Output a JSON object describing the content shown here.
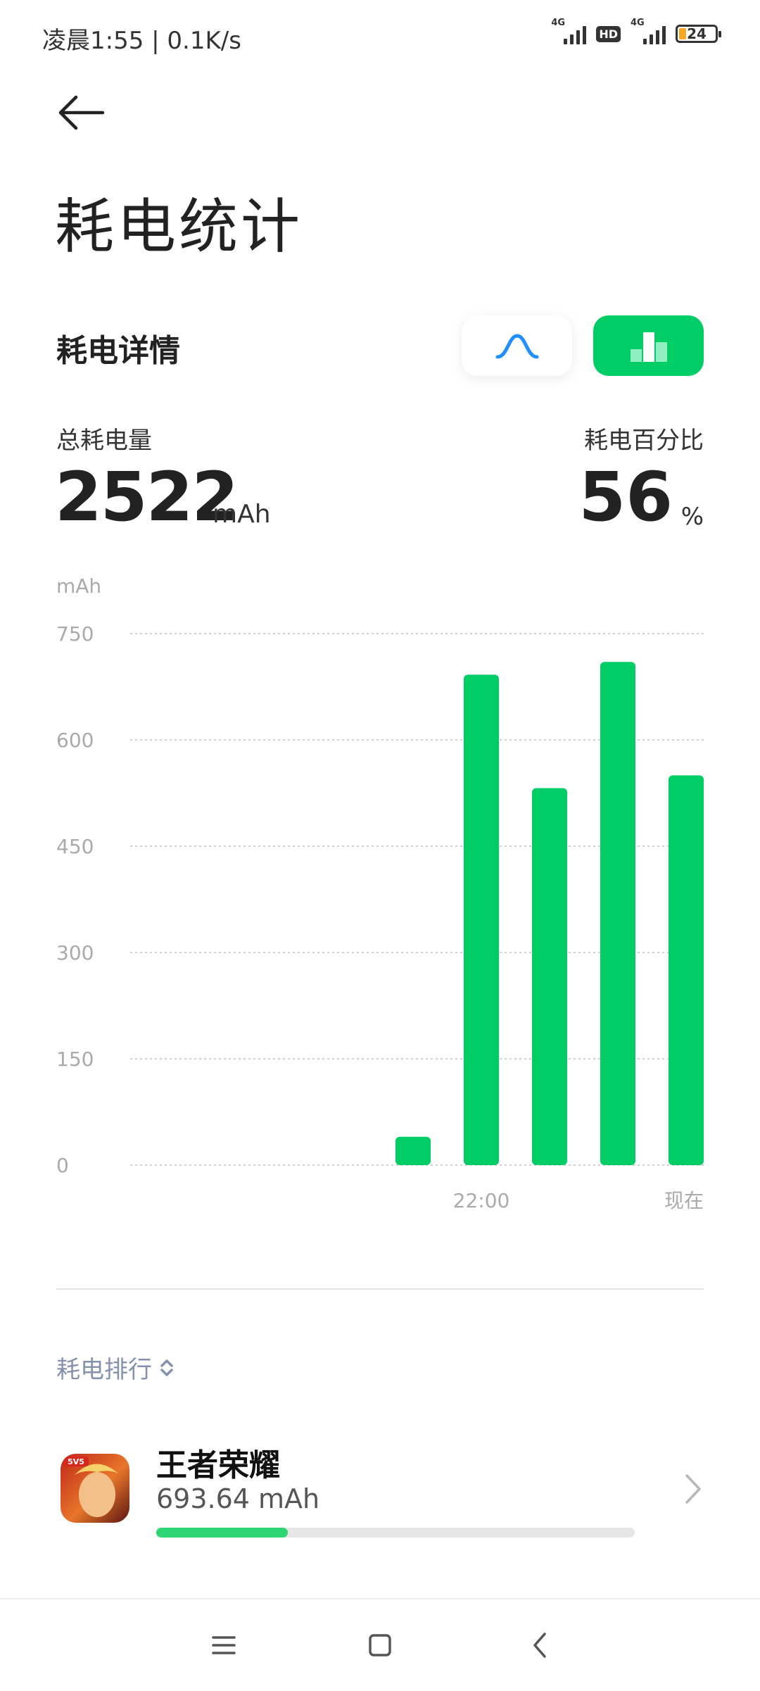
{
  "status_bar": {
    "time_text": "凌晨1:55 | 0.1K/s",
    "network1": "4G",
    "hd": "HD",
    "network2": "4G",
    "battery": "24"
  },
  "header": {
    "title": "耗电统计"
  },
  "details": {
    "title": "耗电详情",
    "view_modes": [
      "curve",
      "bar"
    ],
    "selected_view": "bar",
    "total_label": "总耗电量",
    "total_value": "2522",
    "total_unit": "mAh",
    "percent_label": "耗电百分比",
    "percent_value": "56",
    "percent_unit": "%"
  },
  "chart_data": {
    "type": "bar",
    "ylabel": "mAh",
    "ylim": [
      0,
      750
    ],
    "yticks": [
      "750",
      "600",
      "450",
      "300",
      "150",
      "0"
    ],
    "xtick_labels": [
      {
        "index": 5,
        "label": "22:00"
      },
      {
        "index": 8,
        "label": "现在"
      }
    ],
    "values": [
      0,
      0,
      0,
      0,
      40,
      692,
      532,
      710,
      550
    ],
    "color": "#00cd66",
    "grid": true
  },
  "ranking": {
    "sort_label": "耗电排行",
    "apps": [
      {
        "name": "王者荣耀",
        "value": "693.64 mAh",
        "fraction": 0.275
      }
    ]
  },
  "colors": {
    "accent": "#00cd66",
    "curve_icon": "#1e90ff",
    "muted_text": "#8592ad"
  },
  "navbar": {
    "items": [
      "menu-icon",
      "home-icon",
      "back-icon"
    ]
  }
}
